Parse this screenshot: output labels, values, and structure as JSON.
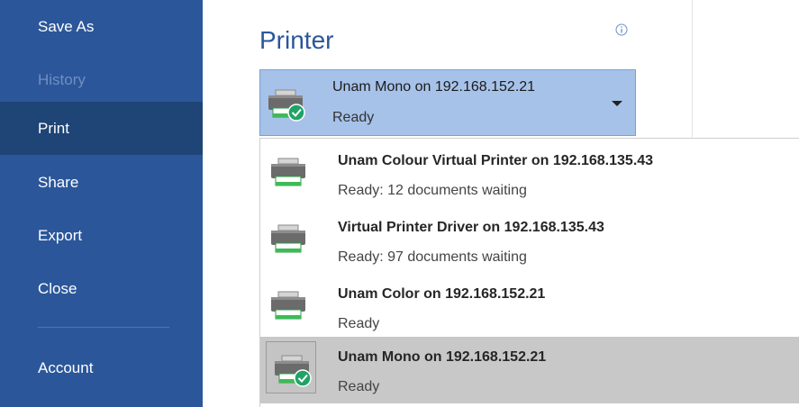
{
  "nav": {
    "items": [
      {
        "label": "Save As",
        "state": "normal"
      },
      {
        "label": "History",
        "state": "disabled"
      },
      {
        "label": "Print",
        "state": "selected"
      },
      {
        "label": "Share",
        "state": "normal"
      },
      {
        "label": "Export",
        "state": "normal"
      },
      {
        "label": "Close",
        "state": "normal"
      },
      {
        "label": "Account",
        "state": "normal"
      }
    ]
  },
  "main": {
    "title": "Printer",
    "info_icon": "info-icon",
    "printer_select": {
      "name": "Unam Mono on 192.168.152.21",
      "status": "Ready",
      "icon": "printer-ready-icon"
    },
    "printers": [
      {
        "name": "Unam Colour Virtual Printer on 192.168.135.43",
        "status": "Ready: 12 documents waiting",
        "icon": "printer-icon"
      },
      {
        "name": "Virtual Printer Driver on 192.168.135.43",
        "status": "Ready: 97 documents waiting",
        "icon": "printer-icon"
      },
      {
        "name": "Unam Color on 192.168.152.21",
        "status": "Ready",
        "icon": "printer-icon"
      },
      {
        "name": "Unam Mono on 192.168.152.21",
        "status": "Ready",
        "icon": "printer-ready-icon",
        "selected": true
      }
    ]
  },
  "colors": {
    "nav_bg": "#2b579a",
    "nav_selected": "#1f4476",
    "accent": "#2b579a",
    "select_bg": "#a6c2e9",
    "option_selected_bg": "#c8c8c8",
    "ready_check": "#21a366"
  }
}
